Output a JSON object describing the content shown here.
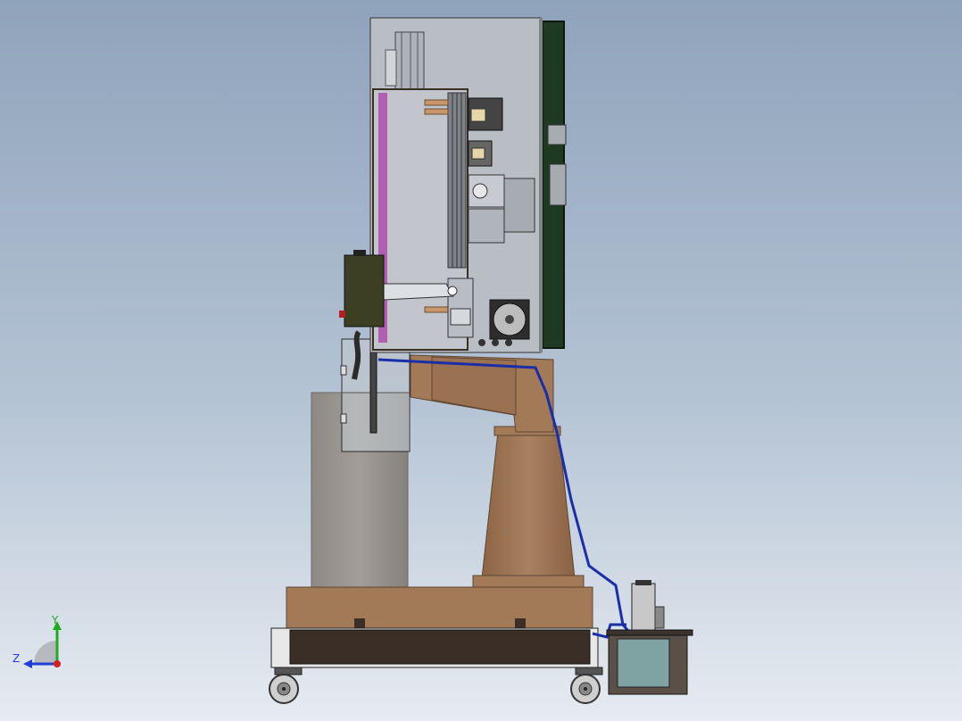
{
  "triad": {
    "y_label": "Y",
    "z_label": "Z",
    "y_color": "#1faa1f",
    "z_color": "#1f3fd8",
    "origin_color": "#d81f1f"
  },
  "colors": {
    "background_top": "#8fa3bb",
    "background_bottom": "#e6ebf1",
    "wood": "#a27a58",
    "cabinet": "#b9bec5",
    "door_panel": "#1e3a22",
    "tank": "#8a8580",
    "hose": "#1a2ea8",
    "base_frame": "#3a2e26",
    "hmi_box": "#3c3f22"
  }
}
